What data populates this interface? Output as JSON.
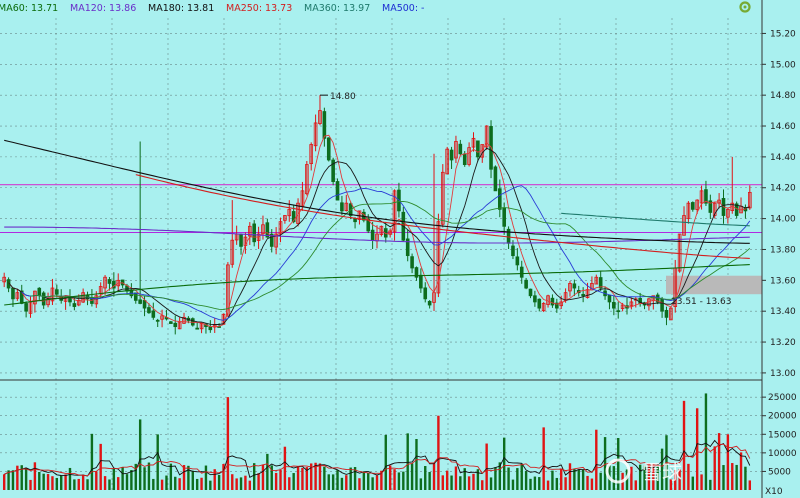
{
  "legend_row": [
    {
      "text": "MA60: 13.71",
      "color": "#0b6b0b"
    },
    {
      "text": "MA120: 13.86",
      "color": "#6a2fc9"
    },
    {
      "text": "MA180: 13.81",
      "color": "#111111"
    },
    {
      "text": "MA250: 13.73",
      "color": "#d21f1f"
    },
    {
      "text": "MA360: 13.97",
      "color": "#1f7a6c"
    },
    {
      "text": "MA500: -",
      "color": "#1f2fd2"
    }
  ],
  "icons": {
    "settings": "gear-icon"
  },
  "price_axis": {
    "ticks": [
      "15.20",
      "15.00",
      "14.80",
      "14.60",
      "14.40",
      "14.20",
      "14.00",
      "13.80",
      "13.60",
      "13.40",
      "13.20",
      "13.00"
    ],
    "min": 12.98,
    "max": 15.3
  },
  "volume_axis": {
    "ticks": [
      "25000",
      "20000",
      "15000",
      "10000",
      "5000"
    ],
    "unit": "X10",
    "max": 28000
  },
  "annotations": {
    "high_label": "14.80",
    "zone_label": "13.51 - 13.63"
  },
  "reference_lines": [
    {
      "price": 14.22,
      "color": "#d03cd0"
    },
    {
      "price": 13.91,
      "color": "#b02ae0"
    }
  ],
  "watermark": "雪球",
  "chart_data": {
    "type": "candlestick",
    "title": "",
    "price_range": [
      12.98,
      15.3
    ],
    "zone": {
      "low": 13.51,
      "high": 13.63
    },
    "high_marker": 14.8,
    "ma_series": [
      {
        "name": "MA60",
        "last": 13.71
      },
      {
        "name": "MA120",
        "last": 13.86
      },
      {
        "name": "MA180",
        "last": 13.81
      },
      {
        "name": "MA250",
        "last": 13.73
      },
      {
        "name": "MA360",
        "last": 13.97
      }
    ],
    "close": [
      13.62,
      13.55,
      13.48,
      13.52,
      13.45,
      13.4,
      13.46,
      13.53,
      13.5,
      13.44,
      13.48,
      13.55,
      13.51,
      13.47,
      13.5,
      13.46,
      13.43,
      13.47,
      13.52,
      13.48,
      13.45,
      13.5,
      13.56,
      13.62,
      13.58,
      13.55,
      13.6,
      13.57,
      13.53,
      13.5,
      13.47,
      13.45,
      13.42,
      13.39,
      13.36,
      13.34,
      13.37,
      13.35,
      13.32,
      13.3,
      13.33,
      13.36,
      13.34,
      13.31,
      13.29,
      13.32,
      13.3,
      13.28,
      13.31,
      13.3,
      13.38,
      13.7,
      13.86,
      13.9,
      13.82,
      13.88,
      13.95,
      13.85,
      13.9,
      13.96,
      13.88,
      13.82,
      13.9,
      13.98,
      14.02,
      14.06,
      13.98,
      14.1,
      14.18,
      14.35,
      14.48,
      14.62,
      14.7,
      14.52,
      14.38,
      14.24,
      14.12,
      14.05,
      14.1,
      14.02,
      13.98,
      14.05,
      13.99,
      13.92,
      13.86,
      13.9,
      13.95,
      13.88,
      13.92,
      14.18,
      14.05,
      13.86,
      13.76,
      13.68,
      13.62,
      13.55,
      13.48,
      13.44,
      13.52,
      13.98,
      14.3,
      14.45,
      14.38,
      14.5,
      14.42,
      14.35,
      14.46,
      14.52,
      14.4,
      14.48,
      14.6,
      14.32,
      14.18,
      14.06,
      13.95,
      13.84,
      13.76,
      13.7,
      13.62,
      13.55,
      13.5,
      13.46,
      13.42,
      13.45,
      13.5,
      13.44,
      13.42,
      13.46,
      13.52,
      13.58,
      13.55,
      13.52,
      13.5,
      13.54,
      13.58,
      13.62,
      13.55,
      13.5,
      13.46,
      13.42,
      13.4,
      13.44,
      13.42,
      13.46,
      13.48,
      13.45,
      13.44,
      13.48,
      13.5,
      13.46,
      13.4,
      13.36,
      13.42,
      13.68,
      13.9,
      14.02,
      14.1,
      14.06,
      14.12,
      14.18,
      14.1,
      14.04,
      14.1,
      14.12,
      14.02,
      14.06,
      14.1,
      14.02,
      14.08,
      14.05,
      14.17
    ]
  }
}
